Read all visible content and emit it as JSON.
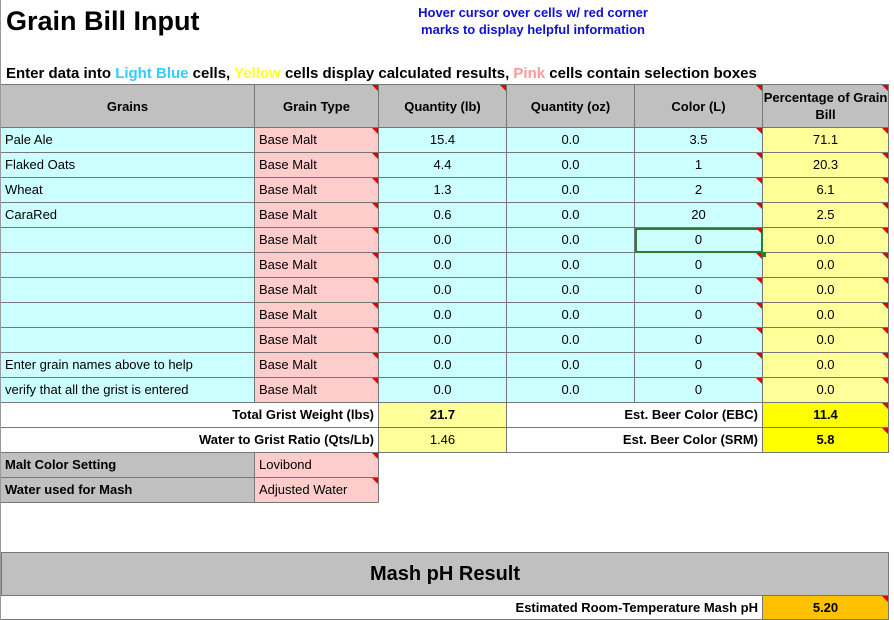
{
  "title": "Grain Bill Input",
  "hint": "Hover cursor over cells w/ red corner marks to display helpful information",
  "instructions": {
    "prefix": "Enter data into ",
    "light_blue": "Light Blue",
    "cells1": " cells, ",
    "yellow": "Yellow",
    "cells2": " cells display calculated results, ",
    "pink": "Pink",
    "cells3": " cells contain selection boxes"
  },
  "colors": {
    "light_blue": "#ccffff",
    "pink": "#ffcccc",
    "yellow": "#ffff99",
    "bright_yellow": "#ffff00",
    "orange": "#ffc000",
    "header_gray": "#c0c0c0"
  },
  "headers": [
    "Grains",
    "Grain Type",
    "Quantity (lb)",
    "Quantity (oz)",
    "Color (L)",
    "Percentage of Grain Bill"
  ],
  "rows": [
    [
      "Pale Ale",
      "Base Malt",
      "15.4",
      "0.0",
      "3.5",
      "71.1"
    ],
    [
      "Flaked Oats",
      "Base Malt",
      "4.4",
      "0.0",
      "1",
      "20.3"
    ],
    [
      "Wheat",
      "Base Malt",
      "1.3",
      "0.0",
      "2",
      "6.1"
    ],
    [
      "CaraRed",
      "Base Malt",
      "0.6",
      "0.0",
      "20",
      "2.5"
    ],
    [
      "",
      "Base Malt",
      "0.0",
      "0.0",
      "0",
      "0.0"
    ],
    [
      "",
      "Base Malt",
      "0.0",
      "0.0",
      "0",
      "0.0"
    ],
    [
      "",
      "Base Malt",
      "0.0",
      "0.0",
      "0",
      "0.0"
    ],
    [
      "",
      "Base Malt",
      "0.0",
      "0.0",
      "0",
      "0.0"
    ],
    [
      "",
      "Base Malt",
      "0.0",
      "0.0",
      "0",
      "0.0"
    ],
    [
      "Enter grain names above to help",
      "Base Malt",
      "0.0",
      "0.0",
      "0",
      "0.0"
    ],
    [
      "verify that all the grist is entered",
      "Base Malt",
      "0.0",
      "0.0",
      "0",
      "0.0"
    ]
  ],
  "summary": {
    "total_grist_label": "Total Grist Weight (lbs)",
    "total_grist_value": "21.7",
    "ebc_label": "Est. Beer Color (EBC)",
    "ebc_value": "11.4",
    "water_ratio_label": "Water to Grist Ratio (Qts/Lb)",
    "water_ratio_value": "1.46",
    "srm_label": "Est. Beer Color (SRM)",
    "srm_value": "5.8"
  },
  "settings": {
    "malt_color_label": "Malt Color Setting",
    "malt_color_value": "Lovibond",
    "water_mash_label": "Water used for Mash",
    "water_mash_value": "Adjusted Water"
  },
  "result": {
    "banner": "Mash pH Result",
    "ph_label": "Estimated Room-Temperature Mash pH",
    "ph_value": "5.20"
  }
}
